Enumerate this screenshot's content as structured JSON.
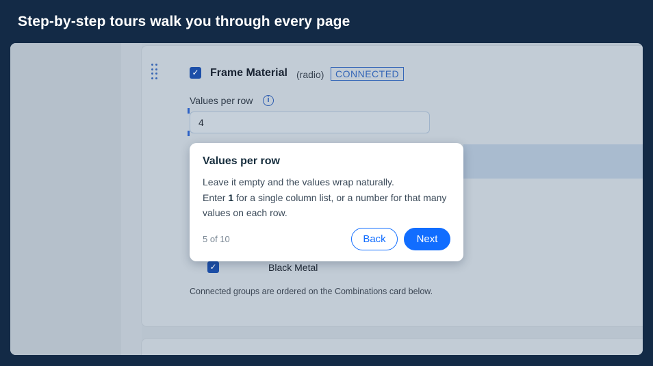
{
  "headline": "Step-by-step tours walk you through every page",
  "group": {
    "title": "Frame Material",
    "type": "(radio)",
    "badge": "CONNECTED",
    "field_label": "Values per row",
    "field_value": "4",
    "value_label": "Black Metal",
    "footnote": "Connected groups are ordered on the Combinations card below."
  },
  "tooltip": {
    "title": "Values per row",
    "line1": "Leave it empty and the values wrap naturally.",
    "line2_pre": "Enter ",
    "line2_bold": "1",
    "line2_post": " for a single column list, or a number for that many values on each row.",
    "step": "5 of 10",
    "back_label": "Back",
    "next_label": "Next"
  },
  "colors": {
    "background": "#132a46",
    "accent": "#116dff"
  }
}
